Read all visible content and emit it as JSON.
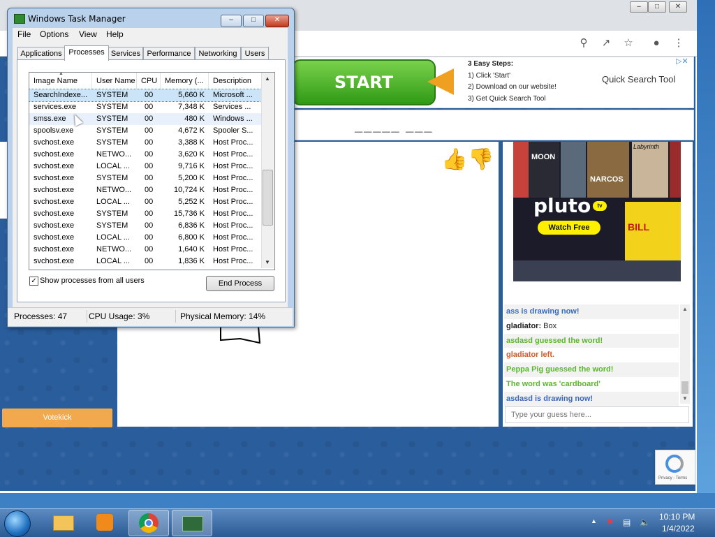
{
  "browser": {
    "ad": {
      "start_label": "START",
      "steps_title": "3 Easy Steps:",
      "step1": "1) Click 'Start'",
      "step2": "2) Download on our website!",
      "step3": "3) Get Quick Search Tool",
      "brand": "Quick Search Tool"
    },
    "word_hint": "_____ ___",
    "votekick": "Votekick",
    "pluto": {
      "logo": "pluto",
      "tv": "tv",
      "cta": "Watch Free",
      "posters": [
        "MOON",
        "NARCOS",
        "Labyrinth",
        "BILL",
        "KILL BILL"
      ]
    },
    "chat": [
      {
        "text": "ass is drawing now!",
        "color": "#3a69b8",
        "bold": true
      },
      {
        "user": "gladiator:",
        "text": " Box",
        "color": "#222222"
      },
      {
        "text": "asdasd guessed the word!",
        "color": "#5cb531",
        "bold": true
      },
      {
        "text": "gladiator left.",
        "color": "#d45a2a",
        "bold": true
      },
      {
        "text": "Peppa Pig guessed the word!",
        "color": "#5cb531",
        "bold": true
      },
      {
        "text": "The word was 'cardboard'",
        "color": "#5cb531",
        "bold": true
      },
      {
        "text": "asdasd is drawing now!",
        "color": "#3a69b8",
        "bold": true
      }
    ],
    "guess_placeholder": "Type your guess here...",
    "recaptcha": "Privacy - Terms"
  },
  "task_manager": {
    "title": "Windows Task Manager",
    "menu": [
      "File",
      "Options",
      "View",
      "Help"
    ],
    "tabs": [
      "Applications",
      "Processes",
      "Services",
      "Performance",
      "Networking",
      "Users"
    ],
    "active_tab": "Processes",
    "columns": [
      "Image Name",
      "User Name",
      "CPU",
      "Memory (...",
      "Description"
    ],
    "processes": [
      [
        "SearchIndexe...",
        "SYSTEM",
        "00",
        "5,660 K",
        "Microsoft ..."
      ],
      [
        "services.exe",
        "SYSTEM",
        "00",
        "7,348 K",
        "Services ..."
      ],
      [
        "smss.exe",
        "SYSTEM",
        "00",
        "480 K",
        "Windows ..."
      ],
      [
        "spoolsv.exe",
        "SYSTEM",
        "00",
        "4,672 K",
        "Spooler S..."
      ],
      [
        "svchost.exe",
        "SYSTEM",
        "00",
        "3,388 K",
        "Host Proc..."
      ],
      [
        "svchost.exe",
        "NETWO...",
        "00",
        "3,620 K",
        "Host Proc..."
      ],
      [
        "svchost.exe",
        "LOCAL ...",
        "00",
        "9,716 K",
        "Host Proc..."
      ],
      [
        "svchost.exe",
        "SYSTEM",
        "00",
        "5,200 K",
        "Host Proc..."
      ],
      [
        "svchost.exe",
        "NETWO...",
        "00",
        "10,724 K",
        "Host Proc..."
      ],
      [
        "svchost.exe",
        "LOCAL ...",
        "00",
        "5,252 K",
        "Host Proc..."
      ],
      [
        "svchost.exe",
        "SYSTEM",
        "00",
        "15,736 K",
        "Host Proc..."
      ],
      [
        "svchost.exe",
        "SYSTEM",
        "00",
        "6,836 K",
        "Host Proc..."
      ],
      [
        "svchost.exe",
        "LOCAL ...",
        "00",
        "6,800 K",
        "Host Proc..."
      ],
      [
        "svchost.exe",
        "NETWO...",
        "00",
        "1,640 K",
        "Host Proc..."
      ],
      [
        "svchost.exe",
        "LOCAL ...",
        "00",
        "1,836 K",
        "Host Proc..."
      ]
    ],
    "selected_row": 0,
    "show_all_label": "Show processes from all users",
    "show_all_checked": true,
    "end_process": "End Process",
    "status": {
      "processes": "Processes: 47",
      "cpu": "CPU Usage: 3%",
      "memory": "Physical Memory: 14%"
    }
  },
  "taskbar": {
    "time": "10:10 PM",
    "date": "1/4/2022"
  }
}
